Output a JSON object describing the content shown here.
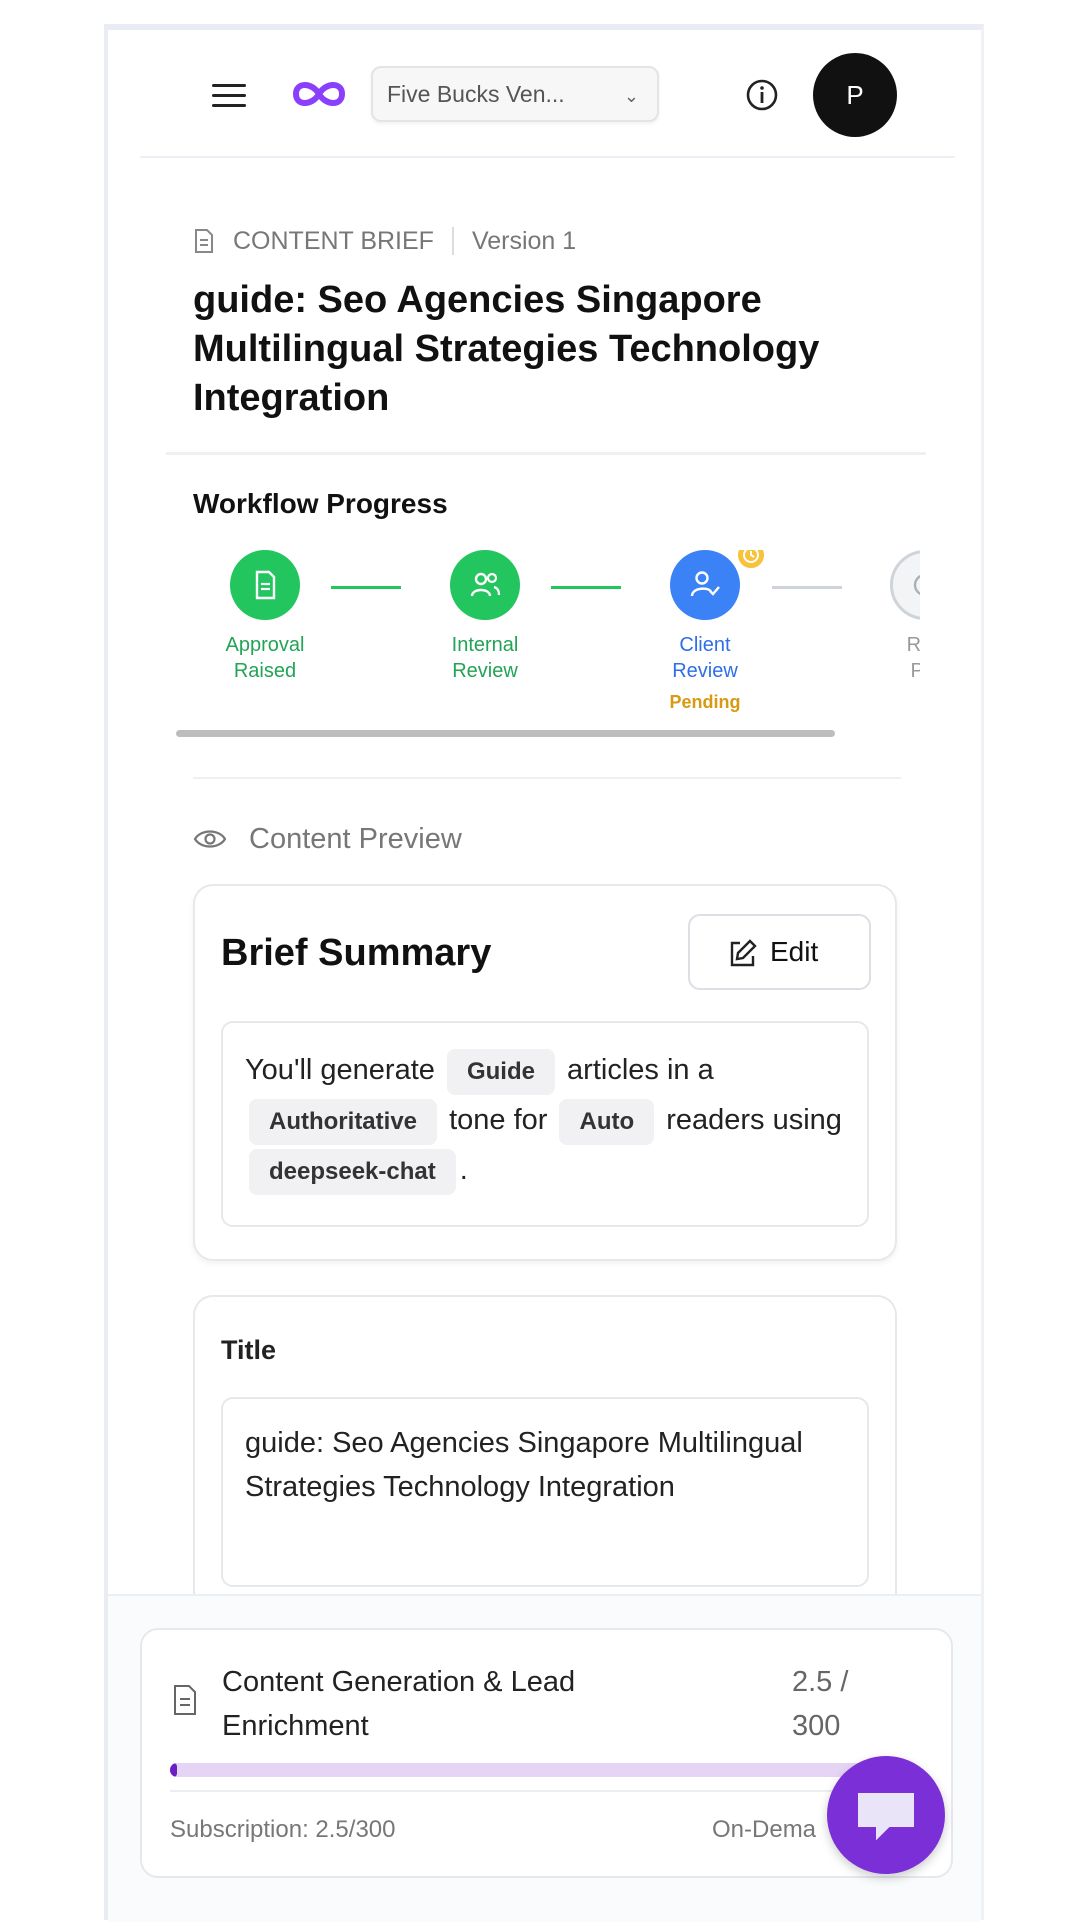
{
  "header": {
    "org_name": "Five Bucks Ven...",
    "avatar_initial": "P",
    "icons": {
      "menu": "hamburger-menu-icon",
      "logo": "infinity-logo-icon",
      "info": "info-icon",
      "chevron": "chevron-down-icon"
    },
    "brand_color": "#8a3ffc"
  },
  "brief": {
    "type_label": "CONTENT BRIEF",
    "version": "Version 1",
    "title": "guide: Seo Agencies Singapore Multilingual Strategies Technology Integration"
  },
  "workflow": {
    "title": "Workflow Progress",
    "steps": [
      {
        "label_line1": "Approval",
        "label_line2": "Raised",
        "state": "complete",
        "icon": "document-icon"
      },
      {
        "label_line1": "Internal",
        "label_line2": "Review",
        "state": "complete",
        "icon": "users-icon"
      },
      {
        "label_line1": "Client",
        "label_line2": "Review",
        "state": "current",
        "status": "Pending",
        "icon": "user-check-icon"
      },
      {
        "label_line1": "Rea",
        "label_line2": "Pul",
        "state": "upcoming",
        "icon": "clock-icon"
      }
    ],
    "colors": {
      "complete": "#22c55e",
      "current": "#3b82f6",
      "pending": "#d89a12",
      "upcoming": "#cfd4da"
    }
  },
  "preview": {
    "label": "Content Preview",
    "summary_title": "Brief Summary",
    "edit_label": "Edit",
    "summary": {
      "t1": "You'll generate",
      "chip1": "Guide",
      "t2": "articles in a",
      "chip2": "Authoritative",
      "t3": "tone for",
      "chip3": "Auto",
      "t4": "readers using",
      "chip4": "deepseek-chat",
      "t5": "."
    },
    "title_label": "Title",
    "title_value": "guide: Seo Agencies Singapore Multilingual Strategies Technology Integration"
  },
  "usage": {
    "title": "Content Generation & Lead Enrichment",
    "count": "2.5 / 300",
    "used": 2.5,
    "limit": 300,
    "subscription_text": "Subscription: 2.5/300",
    "on_demand_text": "On-Dema",
    "bar_color": "#6a1fc4",
    "bar_track_color": "#e6d4f5"
  },
  "chat": {
    "icon": "chat-bubble-icon",
    "color": "#7b2fd6"
  }
}
